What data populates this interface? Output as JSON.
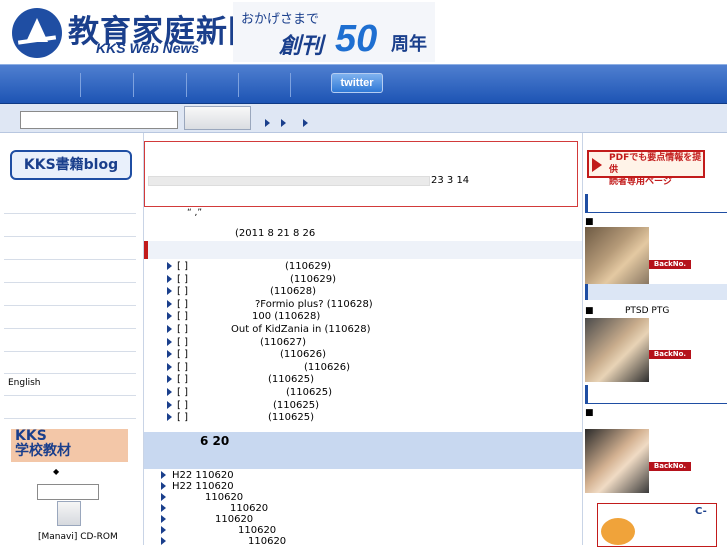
{
  "header": {
    "logo_title": "教育家庭新聞",
    "logo_subtitle": "KKS Web News",
    "anniversary_prefix": "おかげさまで",
    "anniversary_main": "創刊",
    "anniversary_number": "50",
    "anniversary_suffix": "周年"
  },
  "nav": {
    "twitter_label": "twitter"
  },
  "sidebar_left": {
    "blog_button": "KKS書籍blog",
    "english_link": "English",
    "banner_text": "KKS\n学校教材",
    "diamond": "◆",
    "bottom_text": "[Manavi] CD-ROM"
  },
  "announcement": {
    "date": "23 3 14"
  },
  "main": {
    "quote_mark": "“ ,”",
    "date_line": "(2011 8 21  8 26",
    "news_items": [
      {
        "prefix": "[     ]",
        "text": "(110629)"
      },
      {
        "prefix": "[     ]",
        "text": "(110629)"
      },
      {
        "prefix": "[     ]",
        "text": "(110628)"
      },
      {
        "prefix": "[     ]",
        "text": "?Formio plus? (110628)"
      },
      {
        "prefix": "[     ]",
        "text": "100       (110628)"
      },
      {
        "prefix": "[     ]",
        "text": "Out of KidZania in       (110628)"
      },
      {
        "prefix": "[     ]",
        "text": "(110627)"
      },
      {
        "prefix": "[     ]",
        "text": "(110626)"
      },
      {
        "prefix": "[     ]",
        "text": "(110626)"
      },
      {
        "prefix": "[     ]",
        "text": "(110625)"
      },
      {
        "prefix": "[     ]",
        "text": "(110625)"
      },
      {
        "prefix": "[     ]",
        "text": "(110625)"
      },
      {
        "prefix": "[     ]",
        "text": "(110625)"
      }
    ],
    "section2_title": "6  20",
    "section2_items": [
      "H22                 110620",
      "H22                          110620",
      "110620",
      "110620",
      "110620",
      "110620",
      "110620"
    ]
  },
  "sidebar_right": {
    "pdf_banner_line1": "PDFでも要点情報を提供",
    "pdf_banner_line2": "読者専用ページ",
    "square": "■",
    "ptsd_label": "PTSD     PTG",
    "backno_label": "BackNo.",
    "c_label": "C-"
  },
  "colors": {
    "brand_blue": "#1f4ea3",
    "nav_blue": "#1d54b4",
    "accent_red": "#c21b1b",
    "section_bg": "#c8d8f0"
  }
}
